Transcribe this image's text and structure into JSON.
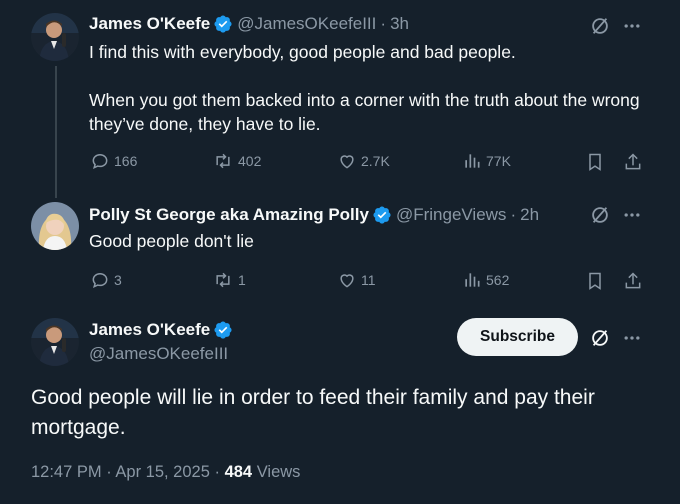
{
  "tweets": [
    {
      "name": "James O'Keefe",
      "handle": "@JamesOKeefeIII",
      "time": "3h",
      "paragraphs": [
        "I find this with everybody, good people and bad people.",
        "When you got them backed into a corner with the truth about the wrong they’ve done, they have to lie."
      ],
      "replies": "166",
      "reposts": "402",
      "likes": "2.7K",
      "views": "77K"
    },
    {
      "name": "Polly St George aka Amazing Polly",
      "handle": "@FringeViews",
      "time": "2h",
      "text": "Good people don't lie",
      "replies": "3",
      "reposts": "1",
      "likes": "11",
      "views": "562"
    }
  ],
  "main_tweet": {
    "name": "James O'Keefe",
    "handle": "@JamesOKeefeIII",
    "subscribe_label": "Subscribe",
    "text": "Good people will lie in order to feed their family and pay their mortgage.",
    "timestamp": "12:47 PM",
    "date": "Apr 15, 2025",
    "views_count": "484",
    "views_label": "Views"
  },
  "icons": {
    "verified": "verified-badge-icon",
    "grok": "grok-icon",
    "more": "more-icon",
    "reply": "reply-icon",
    "repost": "repost-icon",
    "like": "like-icon",
    "views": "views-icon",
    "bookmark": "bookmark-icon",
    "share": "share-icon"
  },
  "colors": {
    "background": "#15202b",
    "verified": "#1d9bf0",
    "muted": "#8b98a5",
    "text": "#f7f9f9"
  }
}
